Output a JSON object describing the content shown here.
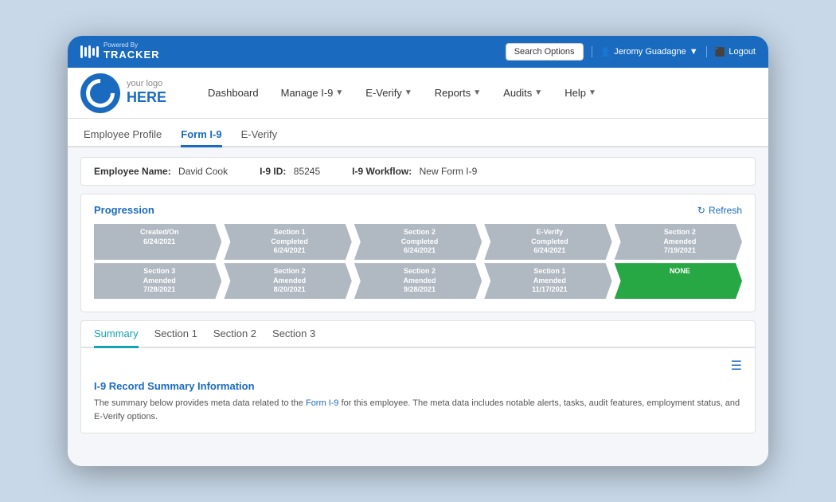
{
  "topbar": {
    "logo_text": "TRACKER",
    "powered_by": "Powered By",
    "search_options": "Search Options",
    "user_name": "Jeromy Guadagne",
    "logout": "Logout"
  },
  "nav": {
    "logo_line1": "your logo",
    "logo_line2": "HERE",
    "items": [
      {
        "label": "Dashboard",
        "has_arrow": false
      },
      {
        "label": "Manage I-9",
        "has_arrow": true
      },
      {
        "label": "E-Verify",
        "has_arrow": true
      },
      {
        "label": "Reports",
        "has_arrow": true
      },
      {
        "label": "Audits",
        "has_arrow": true
      },
      {
        "label": "Help",
        "has_arrow": true
      }
    ]
  },
  "sub_tabs": [
    {
      "label": "Employee Profile",
      "active": false
    },
    {
      "label": "Form I-9",
      "active": true
    },
    {
      "label": "E-Verify",
      "active": false
    }
  ],
  "employee_info": {
    "name_label": "Employee Name:",
    "name_value": "David Cook",
    "id_label": "I-9 ID:",
    "id_value": "85245",
    "workflow_label": "I-9 Workflow:",
    "workflow_value": "New Form I-9"
  },
  "progression": {
    "title": "Progression",
    "refresh": "Refresh",
    "row1": [
      {
        "line1": "Created/On",
        "line2": "6/24/2021"
      },
      {
        "line1": "Section 1",
        "line2": "Completed",
        "line3": "6/24/2021"
      },
      {
        "line1": "Section 2",
        "line2": "Completed",
        "line3": "6/24/2021"
      },
      {
        "line1": "E-Verify",
        "line2": "Completed",
        "line3": "6/24/2021"
      },
      {
        "line1": "Section 2",
        "line2": "Amended",
        "line3": "7/19/2021"
      }
    ],
    "row2": [
      {
        "line1": "Section 3",
        "line2": "Amended",
        "line3": "7/28/2021"
      },
      {
        "line1": "Section 2",
        "line2": "Amended",
        "line3": "8/20/2021"
      },
      {
        "line1": "Section 2",
        "line2": "Amended",
        "line3": "9/28/2021"
      },
      {
        "line1": "Section 1",
        "line2": "Amended",
        "line3": "11/17/2021"
      },
      {
        "line1": "NONE",
        "green": true
      }
    ]
  },
  "section_tabs": [
    {
      "label": "Summary",
      "active": true
    },
    {
      "label": "Section 1",
      "active": false
    },
    {
      "label": "Section 2",
      "active": false
    },
    {
      "label": "Section 3",
      "active": false
    }
  ],
  "summary": {
    "title": "I-9 Record Summary Information",
    "description": "The summary below provides meta data related to the Form I-9 for this employee. The meta data includes notable alerts, tasks, audit features, employment status, and E-Verify options."
  }
}
